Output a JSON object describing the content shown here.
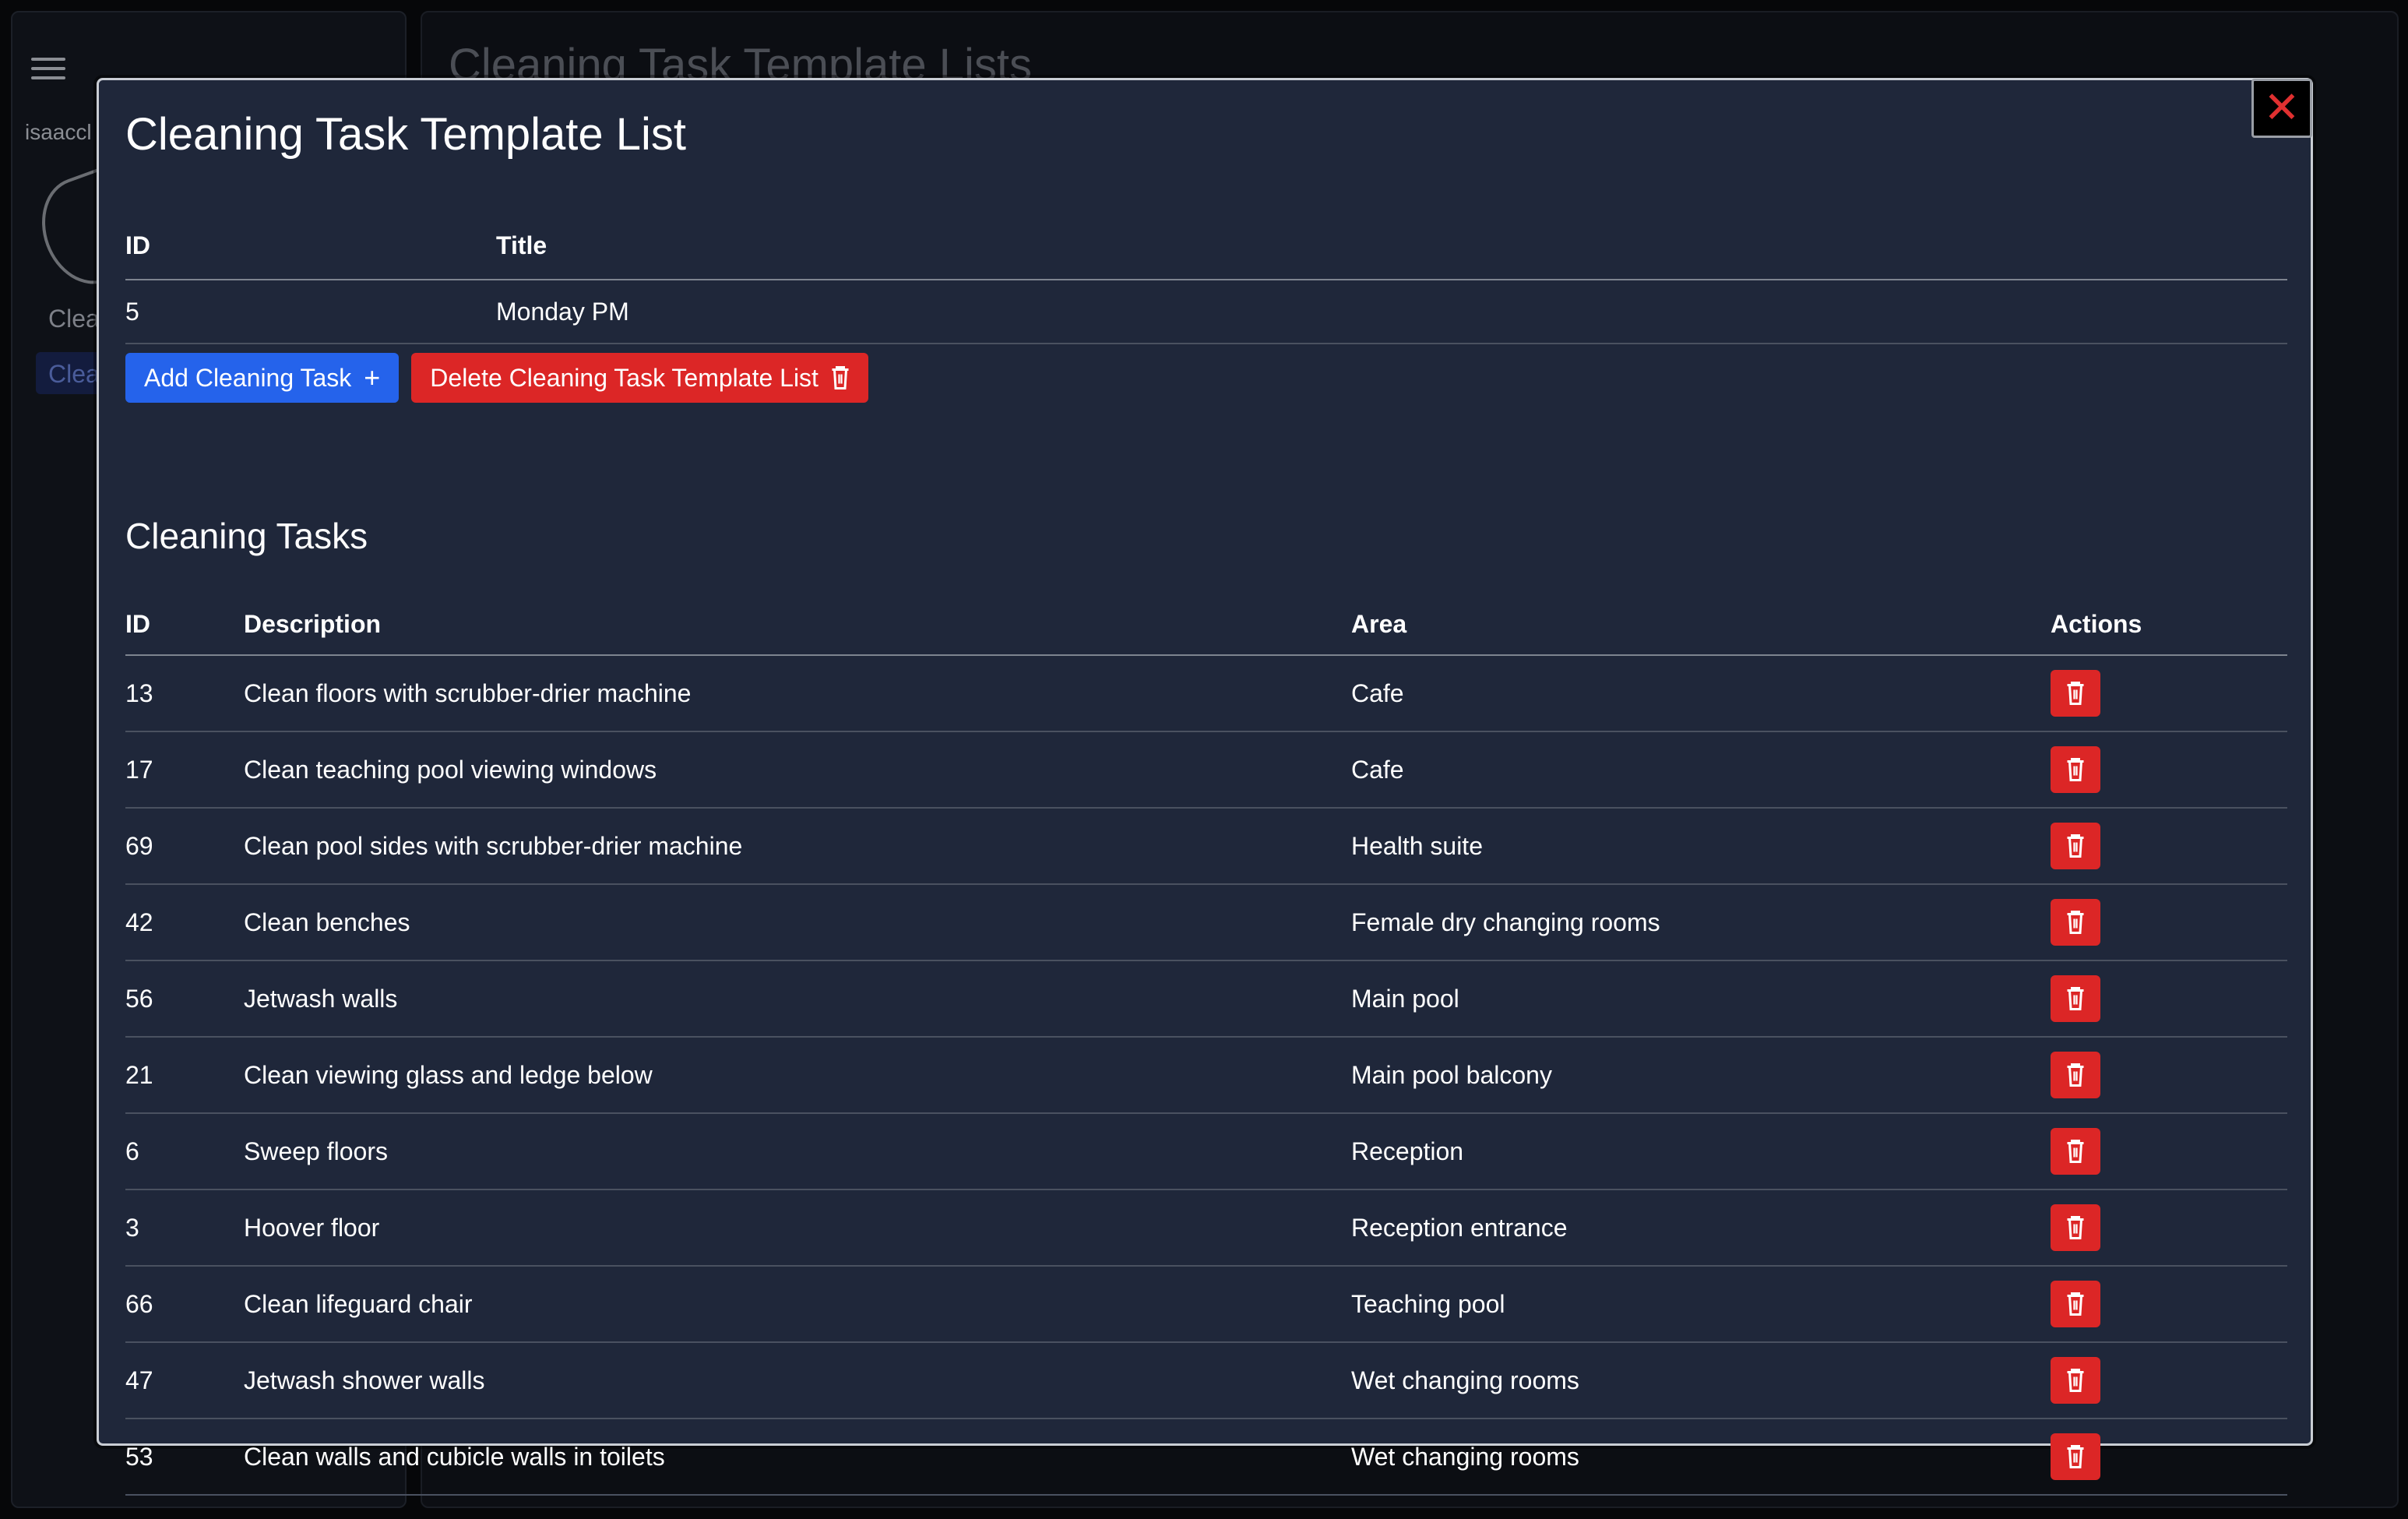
{
  "background": {
    "sidebar": {
      "username": "isaaccl",
      "nav_items": [
        "Clean",
        "Clean"
      ]
    },
    "page_title": "Cleaning Task Template Lists"
  },
  "modal": {
    "title": "Cleaning Task Template List",
    "template_table": {
      "headers": {
        "id": "ID",
        "title": "Title"
      },
      "row": {
        "id": "5",
        "title": "Monday PM"
      }
    },
    "buttons": {
      "add_label": "Add Cleaning Task",
      "add_icon": "+",
      "delete_label": "Delete Cleaning Task Template List"
    },
    "tasks_section_title": "Cleaning Tasks",
    "tasks_table": {
      "headers": {
        "id": "ID",
        "description": "Description",
        "area": "Area",
        "actions": "Actions"
      },
      "rows": [
        {
          "id": "13",
          "description": "Clean floors with scrubber-drier machine",
          "area": "Cafe"
        },
        {
          "id": "17",
          "description": "Clean teaching pool viewing windows",
          "area": "Cafe"
        },
        {
          "id": "69",
          "description": "Clean pool sides with scrubber-drier machine",
          "area": "Health suite"
        },
        {
          "id": "42",
          "description": "Clean benches",
          "area": "Female dry changing rooms"
        },
        {
          "id": "56",
          "description": "Jetwash walls",
          "area": "Main pool"
        },
        {
          "id": "21",
          "description": "Clean viewing glass and ledge below",
          "area": "Main pool balcony"
        },
        {
          "id": "6",
          "description": "Sweep floors",
          "area": "Reception"
        },
        {
          "id": "3",
          "description": "Hoover floor",
          "area": "Reception entrance"
        },
        {
          "id": "66",
          "description": "Clean lifeguard chair",
          "area": "Teaching pool"
        },
        {
          "id": "47",
          "description": "Jetwash shower walls",
          "area": "Wet changing rooms"
        },
        {
          "id": "53",
          "description": "Clean walls and cubicle walls in toilets",
          "area": "Wet changing rooms"
        }
      ]
    },
    "close_icon": "✕"
  },
  "icons": {
    "menu": "hamburger-icon",
    "close": "close-icon",
    "plus": "plus-icon",
    "delete": "trash-icon"
  },
  "colors": {
    "modal_bg": "#1f273a",
    "primary": "#2563eb",
    "danger": "#dc2626",
    "close_x": "#e03030"
  }
}
